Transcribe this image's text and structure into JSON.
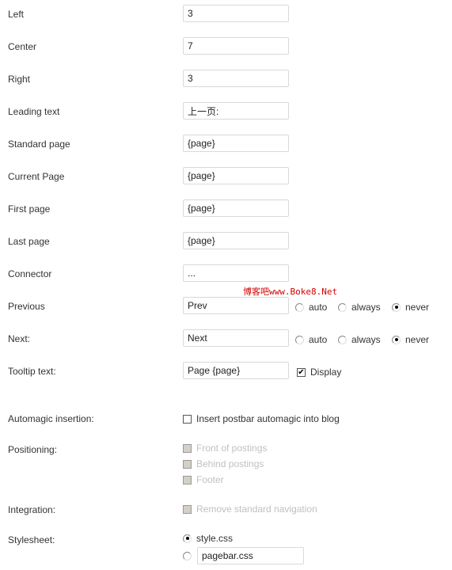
{
  "fields": [
    {
      "label": "Left",
      "value": "3"
    },
    {
      "label": "Center",
      "value": "7"
    },
    {
      "label": "Right",
      "value": "3"
    },
    {
      "label": "Leading text",
      "value": "上一页:"
    },
    {
      "label": "Standard page",
      "value": "{page}"
    },
    {
      "label": "Current Page",
      "value": "{page}"
    },
    {
      "label": "First page",
      "value": "{page}"
    },
    {
      "label": "Last page",
      "value": "{page}"
    },
    {
      "label": "Connector",
      "value": "..."
    }
  ],
  "previous": {
    "label": "Previous",
    "value": "Prev",
    "options": [
      "auto",
      "always",
      "never"
    ],
    "selected": "never"
  },
  "next": {
    "label": "Next:",
    "value": "Next",
    "options": [
      "auto",
      "always",
      "never"
    ],
    "selected": "never"
  },
  "tooltip": {
    "label": "Tooltip text:",
    "value": "Page {page}",
    "display_label": "Display",
    "display_checked": true
  },
  "automagic": {
    "label": "Automagic insertion:",
    "option": "Insert postbar automagic into blog",
    "checked": false
  },
  "positioning": {
    "label": "Positioning:",
    "options": [
      "Front of postings",
      "Behind postings",
      "Footer"
    ]
  },
  "integration": {
    "label": "Integration:",
    "option": "Remove standard navigation"
  },
  "stylesheet": {
    "label": "Stylesheet:",
    "option1": "style.css",
    "option2_value": "pagebar.css"
  },
  "watermark": "博客吧www.Boke8.Net"
}
